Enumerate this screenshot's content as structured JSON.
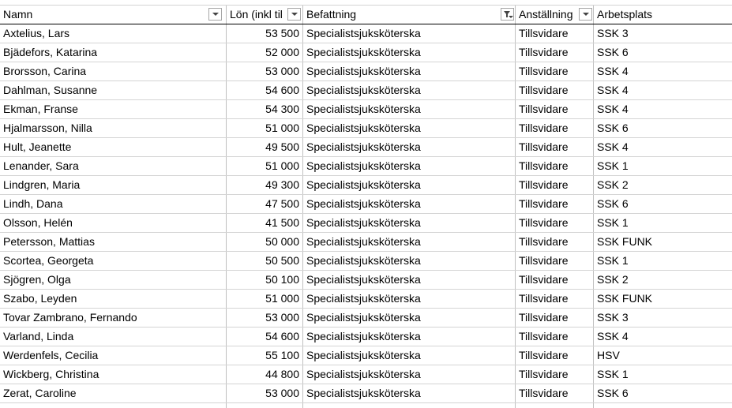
{
  "sheet": {
    "headers": [
      {
        "label": "Namn",
        "filter": "dropdown"
      },
      {
        "label": "Lön (inkl til",
        "filter": "dropdown"
      },
      {
        "label": "Befattning",
        "filter": "filtered"
      },
      {
        "label": "Anställning",
        "filter": "dropdown"
      },
      {
        "label": "Arbetsplats",
        "filter": "none"
      }
    ],
    "rows": [
      [
        "Axtelius, Lars",
        "53 500",
        "Specialistsjuksköterska",
        "Tillsvidare",
        "SSK 3"
      ],
      [
        "Bjädefors, Katarina",
        "52 000",
        "Specialistsjuksköterska",
        "Tillsvidare",
        "SSK 6"
      ],
      [
        "Brorsson, Carina",
        "53 000",
        "Specialistsjuksköterska",
        "Tillsvidare",
        "SSK 4"
      ],
      [
        "Dahlman, Susanne",
        "54 600",
        "Specialistsjuksköterska",
        "Tillsvidare",
        "SSK 4"
      ],
      [
        "Ekman, Franse",
        "54 300",
        "Specialistsjuksköterska",
        "Tillsvidare",
        "SSK 4"
      ],
      [
        "Hjalmarsson, Nilla",
        "51 000",
        "Specialistsjuksköterska",
        "Tillsvidare",
        "SSK 6"
      ],
      [
        "Hult, Jeanette",
        "49 500",
        "Specialistsjuksköterska",
        "Tillsvidare",
        "SSK 4"
      ],
      [
        "Lenander, Sara",
        "51 000",
        "Specialistsjuksköterska",
        "Tillsvidare",
        "SSK 1"
      ],
      [
        "Lindgren, Maria",
        "49 300",
        "Specialistsjuksköterska",
        "Tillsvidare",
        "SSK 2"
      ],
      [
        "Lindh, Dana",
        "47 500",
        "Specialistsjuksköterska",
        "Tillsvidare",
        "SSK 6"
      ],
      [
        "Olsson, Helén",
        "41 500",
        "Specialistsjuksköterska",
        "Tillsvidare",
        "SSK 1"
      ],
      [
        "Petersson, Mattias",
        "50 000",
        "Specialistsjuksköterska",
        "Tillsvidare",
        "SSK FUNK"
      ],
      [
        "Scortea, Georgeta",
        "50 500",
        "Specialistsjuksköterska",
        "Tillsvidare",
        "SSK 1"
      ],
      [
        "Sjögren, Olga",
        "50 100",
        "Specialistsjuksköterska",
        "Tillsvidare",
        "SSK 2"
      ],
      [
        "Szabo, Leyden",
        "51 000",
        "Specialistsjuksköterska",
        "Tillsvidare",
        "SSK FUNK"
      ],
      [
        "Tovar Zambrano, Fernando",
        "53 000",
        "Specialistsjuksköterska",
        "Tillsvidare",
        "SSK 3"
      ],
      [
        "Varland, Linda",
        "54 600",
        "Specialistsjuksköterska",
        "Tillsvidare",
        "SSK 4"
      ],
      [
        "Werdenfels, Cecilia",
        "55 100",
        "Specialistsjuksköterska",
        "Tillsvidare",
        "HSV"
      ],
      [
        "Wickberg, Christina",
        "44 800",
        "Specialistsjuksköterska",
        "Tillsvidare",
        "SSK 1"
      ],
      [
        "Zerat, Caroline",
        "53 000",
        "Specialistsjuksköterska",
        "Tillsvidare",
        "SSK 6"
      ]
    ]
  },
  "colors": {
    "gridline": "#d4d4d4",
    "header_underline": "#000000",
    "filter_border": "#a6a6a6"
  }
}
